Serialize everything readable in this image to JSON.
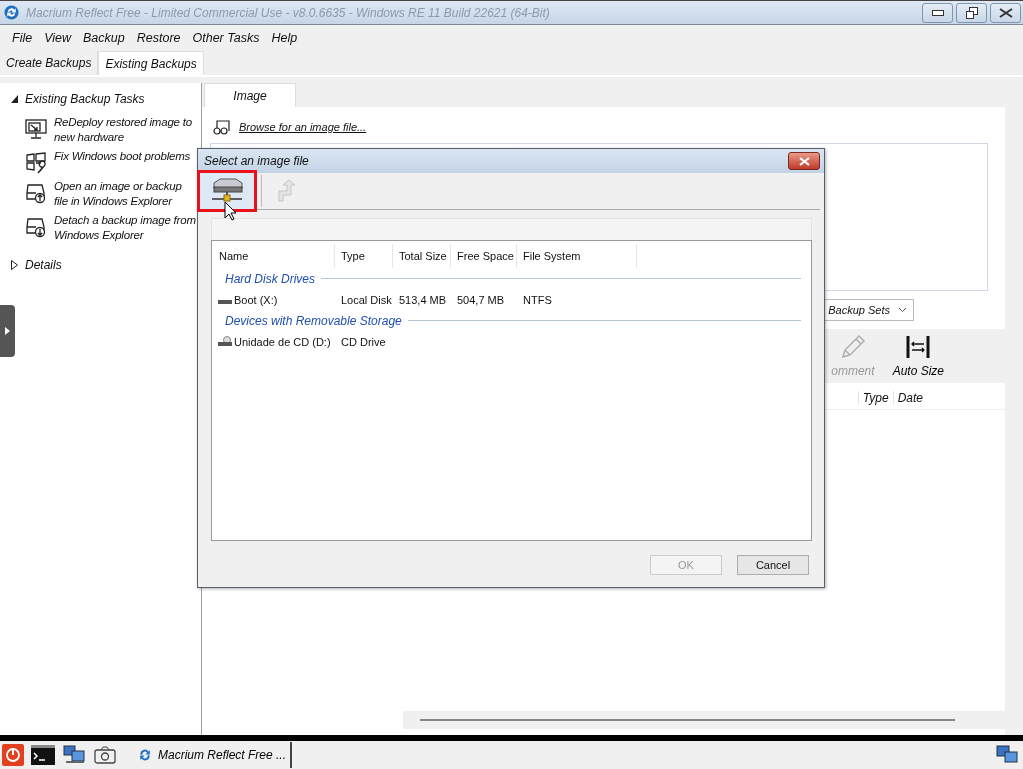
{
  "window": {
    "title": "Macrium Reflect Free - Limited Commercial Use - v8.0.6635 - Windows RE 11 Build 22621 (64-Bit)"
  },
  "menu": [
    "File",
    "View",
    "Backup",
    "Restore",
    "Other Tasks",
    "Help"
  ],
  "tabs": [
    {
      "label": "Create Backups",
      "selected": false
    },
    {
      "label": "Existing Backups",
      "selected": true
    }
  ],
  "sidebar": {
    "sections": [
      {
        "label": "Existing Backup Tasks",
        "expanded": true,
        "items": [
          {
            "kind": "redeploy",
            "label": "ReDeploy restored image to new hardware"
          },
          {
            "kind": "repair",
            "label": "Fix Windows boot problems"
          },
          {
            "kind": "open",
            "label": "Open an image or backup file in Windows Explorer"
          },
          {
            "kind": "detach",
            "label": "Detach a backup image from Windows Explorer"
          }
        ]
      },
      {
        "label": "Details",
        "expanded": false
      }
    ]
  },
  "content": {
    "tabs": [
      {
        "label": "Image",
        "selected": true
      }
    ],
    "browse_link": "Browse for an image file...",
    "filter_dropdown": "Backup Sets",
    "toolbar": [
      {
        "kind": "comment",
        "label": "omment",
        "disabled": true
      },
      {
        "kind": "autosize",
        "label": "Auto Size",
        "disabled": false
      }
    ],
    "columns": [
      "Type",
      "Date"
    ]
  },
  "dialog": {
    "title": "Select an image file",
    "toolbar": [
      {
        "kind": "drives",
        "disabled": false,
        "highlighted": true
      },
      {
        "kind": "up",
        "disabled": true,
        "highlighted": false
      }
    ],
    "columns": [
      "Name",
      "Type",
      "Total Size",
      "Free Space",
      "File System"
    ],
    "groups": [
      {
        "label": "Hard Disk Drives",
        "rows": [
          {
            "kind": "disk",
            "cells": [
              "Boot (X:)",
              "Local Disk",
              "513,4 MB",
              "504,7 MB",
              "NTFS"
            ]
          }
        ]
      },
      {
        "label": "Devices with Removable Storage",
        "rows": [
          {
            "kind": "cd",
            "cells": [
              "Unidade de CD (D:)",
              "CD Drive",
              "",
              "",
              ""
            ]
          }
        ]
      }
    ],
    "buttons": [
      {
        "label": "OK",
        "disabled": true
      },
      {
        "label": "Cancel",
        "disabled": false
      }
    ]
  },
  "taskbar": {
    "window_button": "Macrium Reflect Free ..."
  }
}
